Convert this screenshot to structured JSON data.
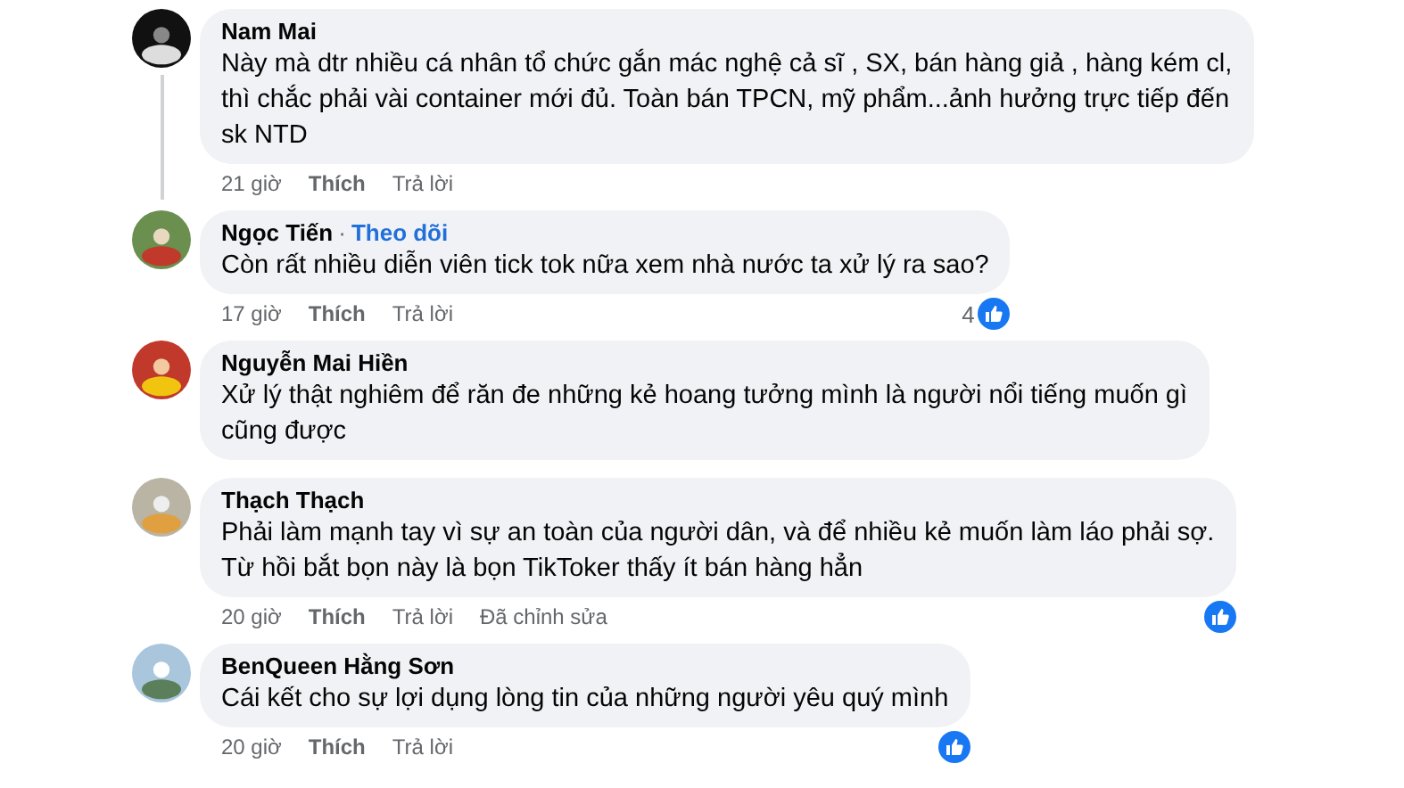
{
  "comments": [
    {
      "author": "Nam Mai",
      "thread": true,
      "lines": [
        "Này mà dtr nhiều cá nhân tổ chức gắn mác nghệ cả sĩ , SX, bán hàng giả , hàng kém cl,",
        "thì chắc phải vài container mới đủ. Toàn bán TPCN, mỹ phẩm...ảnh hưởng trực tiếp đến",
        "sk NTD"
      ],
      "actions": [
        "21 giờ",
        "Thích",
        "Trả lời"
      ]
    },
    {
      "author": "Ngọc Tiến",
      "separator": "·",
      "follow": "Theo dõi",
      "lines": [
        "Còn rất nhiều diễn viên tick tok nữa xem nhà nước ta xử lý ra sao?"
      ],
      "actions": [
        "17 giờ",
        "Thích",
        "Trả lời"
      ],
      "reaction": {
        "kind": "like",
        "count": "4"
      }
    },
    {
      "author": "Nguyễn Mai Hiền",
      "lines": [
        "Xử lý thật nghiêm để răn đe những kẻ hoang tưởng mình là người nổi tiếng muốn gì",
        "cũng được"
      ]
    },
    {
      "author": "Thạch Thạch",
      "lines": [
        "Phải làm mạnh tay vì sự an toàn của người dân, và để nhiều kẻ muốn làm láo phải sợ.",
        "Từ hồi bắt bọn này là bọn TikToker thấy ít bán hàng hẳn"
      ],
      "actions": [
        "20 giờ",
        "Thích",
        "Trả lời",
        "Đã chỉnh sửa"
      ],
      "reaction": {
        "kind": "like"
      }
    },
    {
      "author": "BenQueen Hằng Sơn",
      "lines": [
        "Cái kết cho sự lợi dụng lòng tin của những người yêu quý mình"
      ],
      "actions": [
        "20 giờ",
        "Thích",
        "Trả lời"
      ],
      "reaction": {
        "kind": "like"
      }
    }
  ]
}
